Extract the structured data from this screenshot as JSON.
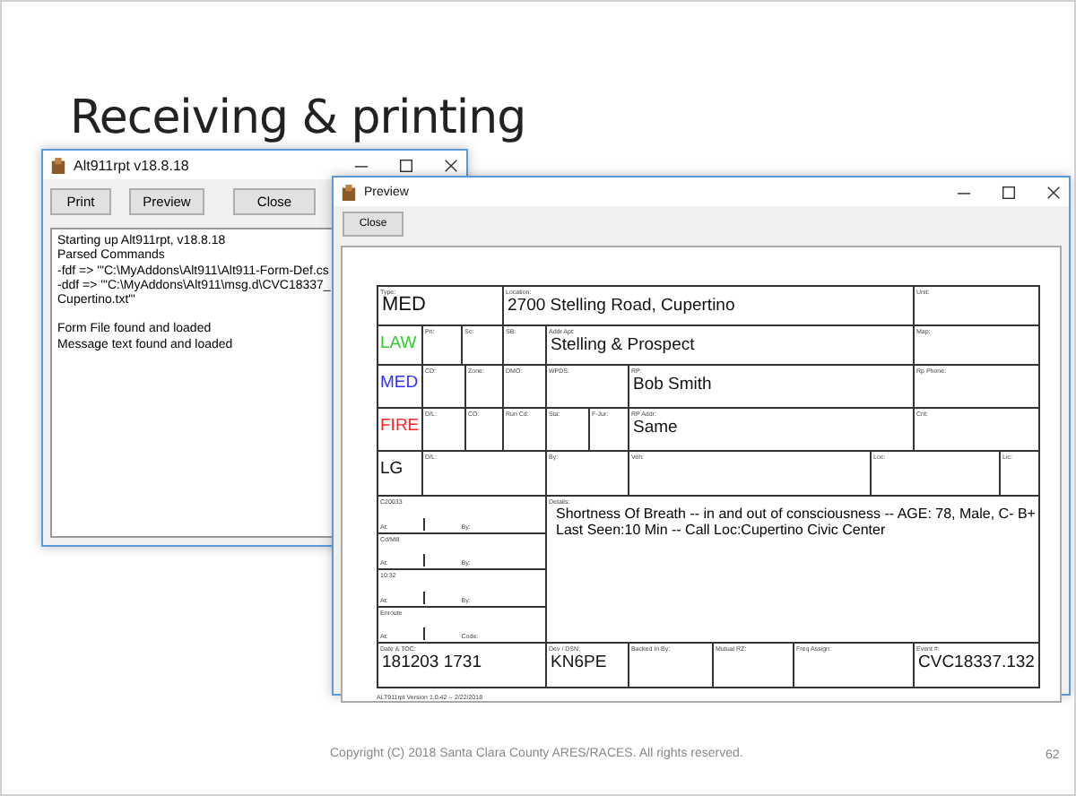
{
  "slide": {
    "title": "Receiving & printing",
    "copyright": "Copyright (C) 2018 Santa Clara County ARES/RACES. All rights reserved.",
    "page_number": "62"
  },
  "main_window": {
    "title": "Alt911rpt v18.8.18",
    "buttons": [
      "Print",
      "Preview",
      "Close"
    ],
    "log": [
      [
        "Starting up Alt911rpt, v18.8.18",
        "Parsed Commands",
        "-fdf => '\"C:\\MyAddons\\Alt911\\Alt911-Form-Def.cs",
        "-ddf => '\"C:\\MyAddons\\Alt911\\msg.d\\CVC18337_",
        "Cupertino.txt\"'"
      ],
      [
        "Form File found and loaded",
        "Message text found and loaded"
      ]
    ]
  },
  "preview_window": {
    "title": "Preview",
    "buttons": [
      "Close"
    ],
    "form": {
      "rows": [
        {
          "kind": "cells",
          "cells": [
            {
              "label": "Type:",
              "value": "MED"
            },
            {
              "label": "Location:",
              "value": "2700 Stelling Road, Cupertino"
            },
            {
              "label": "Unit:"
            }
          ]
        },
        {
          "kind": "cells",
          "cells": [
            {
              "value": "LAW",
              "color": "#33cc33"
            },
            {
              "label": "Pri:"
            },
            {
              "label": "Sc:"
            },
            {
              "label": "SB:"
            },
            {
              "label": "Addr Apt:",
              "value": "Stelling & Prospect"
            },
            {
              "label": "Map:"
            }
          ]
        },
        {
          "kind": "cells",
          "cells": [
            {
              "value": "MED",
              "color": "#3333ff"
            },
            {
              "label": "CD:"
            },
            {
              "label": "Zone:"
            },
            {
              "label": "DMO:"
            },
            {
              "label": "WPDS:"
            },
            {
              "label": "RP:",
              "value": "Bob Smith"
            },
            {
              "label": "Rp Phone:"
            }
          ]
        },
        {
          "kind": "cells",
          "cells": [
            {
              "value": "FIRE",
              "color": "#ff2222"
            },
            {
              "label": "D/L:"
            },
            {
              "label": "CO:"
            },
            {
              "label": "Run Cd:"
            },
            {
              "label": "Sta:"
            },
            {
              "label": "F-Jur:"
            },
            {
              "label": "RP Addr:",
              "value": "Same"
            },
            {
              "label": "Cnt:"
            }
          ]
        },
        {
          "kind": "cells",
          "cells": [
            {
              "value": "LG",
              "color": "#111111"
            },
            {
              "label": "D/L:"
            },
            {
              "label": "By:"
            },
            {
              "label": "Veh:"
            },
            {
              "label": "Loc:"
            },
            {
              "label": "Lic:"
            }
          ]
        },
        {
          "kind": "details",
          "times": [
            {
              "label": "C20033",
              "at": "At:",
              "by": "By:"
            },
            {
              "label": "Cd/Mill",
              "at": "At:",
              "by": "By:"
            },
            {
              "label": "10:32",
              "at": "At:",
              "by": "By:"
            },
            {
              "label": "Enroute",
              "at": "At:",
              "by": "Code:"
            }
          ],
          "label": "Details:",
          "lines": [
            "Shortness Of Breath -- in and out of consciousness -- AGE: 78, Male, C- B+",
            "Last Seen:10 Min -- Call Loc:Cupertino Civic Center"
          ]
        },
        {
          "kind": "cells",
          "cells": [
            {
              "label": "Date & TOC:",
              "value": "181203 1731"
            },
            {
              "label": "Dev / DSN:",
              "value": "KN6PE"
            },
            {
              "label": "Backed In By:"
            },
            {
              "label": "Mutual RZ:"
            },
            {
              "label": "Freq Assign:"
            },
            {
              "label": "Event #:",
              "value": "CVC18337.132"
            }
          ]
        }
      ],
      "footer": "ALT911rpt Version 1.0.42 -- 2/22/2018"
    }
  }
}
